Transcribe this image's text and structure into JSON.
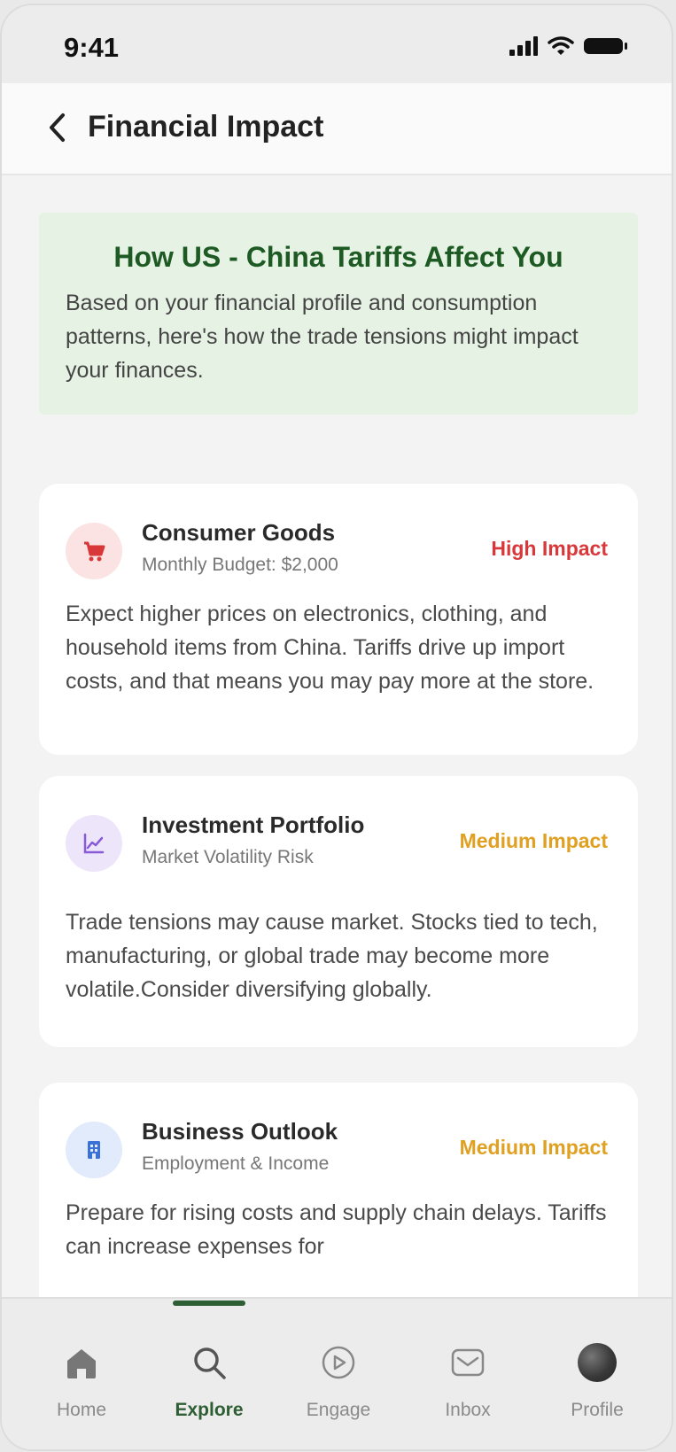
{
  "status_bar": {
    "time": "9:41"
  },
  "header": {
    "title": "Financial Impact"
  },
  "intro": {
    "heading": "How US - China Tariffs Affect You",
    "text": "Based on your financial profile and consumption patterns, here's how the trade tensions might impact your finances."
  },
  "cards": [
    {
      "title": "Consumer Goods",
      "subtitle": "Monthly Budget: $2,000",
      "badge": "High Impact",
      "badge_color": "#d9383a",
      "icon": "cart-icon",
      "icon_bg": "#fbe3e3",
      "icon_color": "#d9383a",
      "body": "Expect higher prices on electronics, clothing, and household items from China. Tariffs drive up import costs, and that means you may pay more at the store."
    },
    {
      "title": "Investment Portfolio",
      "subtitle": "Market Volatility Risk",
      "badge": "Medium Impact",
      "badge_color": "#e0a021",
      "icon": "chart-line-icon",
      "icon_bg": "#ede6fb",
      "icon_color": "#8a5bd6",
      "body": "Trade tensions may cause market. Stocks tied to tech, manufacturing, or global trade may become more volatile.Consider diversifying globally."
    },
    {
      "title": "Business Outlook",
      "subtitle": "Employment & Income",
      "badge": "Medium Impact",
      "badge_color": "#e0a021",
      "icon": "building-icon",
      "icon_bg": "#e1ebfb",
      "icon_color": "#3a72d8",
      "body": "Prepare for rising costs and supply chain delays. Tariffs can increase expenses for"
    }
  ],
  "tab_bar": {
    "tabs": [
      {
        "label": "Home",
        "icon": "home-icon",
        "active": false
      },
      {
        "label": "Explore",
        "icon": "search-icon",
        "active": true
      },
      {
        "label": "Engage",
        "icon": "play-icon",
        "active": false
      },
      {
        "label": "Inbox",
        "icon": "mail-icon",
        "active": false
      },
      {
        "label": "Profile",
        "icon": "avatar",
        "active": false
      }
    ]
  },
  "colors": {
    "accent": "#2e5e33",
    "intro_bg": "#e6f3e4",
    "intro_heading": "#1e5a23"
  }
}
